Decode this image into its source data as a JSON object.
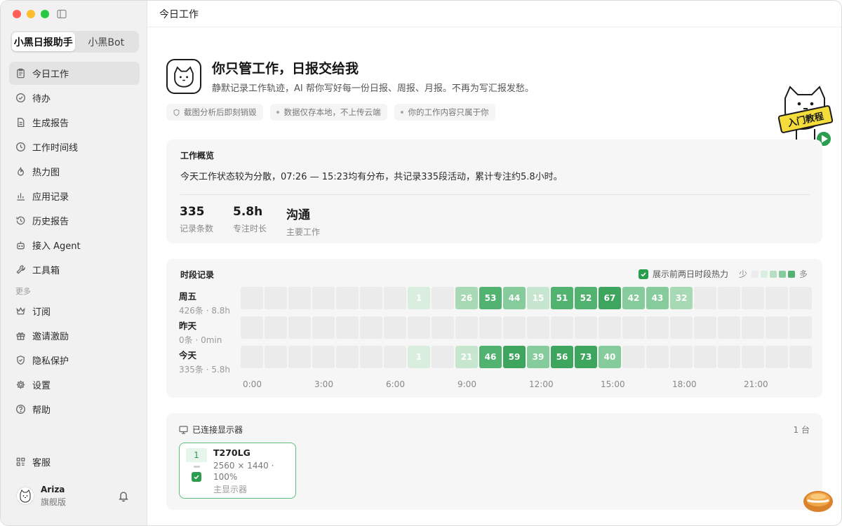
{
  "sidebar": {
    "tabs": [
      {
        "label": "小黑日报助手",
        "active": true
      },
      {
        "label": "小黑Bot",
        "active": false
      }
    ],
    "items": [
      {
        "label": "今日工作",
        "icon": "clipboard-icon",
        "active": true
      },
      {
        "label": "待办",
        "icon": "check-circle-icon"
      },
      {
        "label": "生成报告",
        "icon": "document-icon"
      },
      {
        "label": "工作时间线",
        "icon": "clock-icon"
      },
      {
        "label": "热力图",
        "icon": "flame-icon"
      },
      {
        "label": "应用记录",
        "icon": "bar-chart-icon"
      },
      {
        "label": "历史报告",
        "icon": "history-icon"
      },
      {
        "label": "接入 Agent",
        "icon": "robot-icon"
      },
      {
        "label": "工具箱",
        "icon": "wrench-icon"
      }
    ],
    "more_label": "更多",
    "more_items": [
      {
        "label": "订阅",
        "icon": "crown-icon"
      },
      {
        "label": "邀请激励",
        "icon": "gift-icon"
      },
      {
        "label": "隐私保护",
        "icon": "shield-icon"
      },
      {
        "label": "设置",
        "icon": "gear-icon"
      },
      {
        "label": "帮助",
        "icon": "help-icon"
      }
    ],
    "service_label": "客服",
    "user": {
      "name": "Ariza",
      "plan": "旗舰版"
    }
  },
  "header": {
    "title": "今日工作"
  },
  "hero": {
    "title": "你只管工作，日报交给我",
    "subtitle": "静默记录工作轨迹，AI 帮你写好每一份日报、周报、月报。不再为写汇报发愁。",
    "chips": [
      "截图分析后即刻销毁",
      "数据仅存本地，不上传云端",
      "你的工作内容只属于你"
    ],
    "tutorial_label": "入门教程"
  },
  "overview": {
    "title": "工作概览",
    "summary": "今天工作状态较为分散，07:26 — 15:23均有分布，共记录335段活动，累计专注约5.8小时。",
    "stats": [
      {
        "value": "335",
        "label": "记录条数"
      },
      {
        "value": "5.8h",
        "label": "专注时长"
      },
      {
        "value": "沟通",
        "label": "主要工作"
      }
    ]
  },
  "timeline": {
    "title": "时段记录",
    "show_prev_label": "展示前两日时段热力",
    "legend_low": "少",
    "legend_high": "多",
    "legend_colors": [
      "#ececec",
      "#d9eedf",
      "#b6dfc2",
      "#86cb9b",
      "#52b270"
    ],
    "rows": [
      {
        "name": "周五",
        "sub": "426条 · 8.8h",
        "values": [
          null,
          null,
          null,
          null,
          null,
          null,
          null,
          1,
          null,
          26,
          53,
          44,
          15,
          51,
          52,
          67,
          42,
          43,
          32,
          null,
          null,
          null,
          null,
          null
        ]
      },
      {
        "name": "昨天",
        "sub": "0条 · 0min",
        "values": [
          null,
          null,
          null,
          null,
          null,
          null,
          null,
          null,
          null,
          null,
          null,
          null,
          null,
          null,
          null,
          null,
          null,
          null,
          null,
          null,
          null,
          null,
          null,
          null
        ]
      },
      {
        "name": "今天",
        "sub": "335条 · 5.8h",
        "values": [
          null,
          null,
          null,
          null,
          null,
          null,
          null,
          1,
          null,
          21,
          46,
          59,
          39,
          56,
          73,
          40,
          null,
          null,
          null,
          null,
          null,
          null,
          null,
          null
        ]
      }
    ],
    "hour_labels": [
      "0:00",
      "3:00",
      "6:00",
      "9:00",
      "12:00",
      "15:00",
      "18:00",
      "21:00"
    ]
  },
  "monitors": {
    "title": "已连接显示器",
    "count": "1 台",
    "items": [
      {
        "index": "1",
        "name": "T270LG",
        "spec": "2560 × 1440 · 100%",
        "role": "主显示器",
        "checked": true
      }
    ]
  }
}
